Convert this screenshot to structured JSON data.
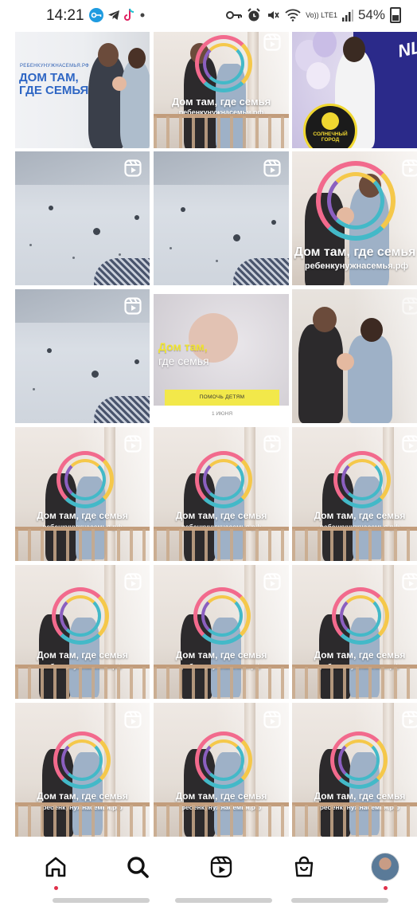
{
  "status_bar": {
    "time": "14:21",
    "network_label": "Vo)) LTE1",
    "battery": "54%",
    "left_icons": [
      "key-icon",
      "telegram-icon",
      "tiktok-icon",
      "dot-icon"
    ],
    "right_icons": [
      "vpn-key-icon",
      "alarm-icon",
      "mute-icon",
      "wifi-icon",
      "signal-icon",
      "battery-icon"
    ]
  },
  "grid": {
    "promo_tile": {
      "site_small": "РЕБЕНКУНУЖНАСЕМЬЯ.РФ",
      "title": "ДОМ ТАМ, ГДЕ СЕМЬЯ"
    },
    "reel_caption": {
      "title": "Дом там, где семья",
      "site": "ребенкунужнасемья.рф"
    },
    "event_tile": {
      "script_text": "NL",
      "badge_text": "СОЛНЕЧНЫЙ ГОРОД"
    },
    "baby_tile": {
      "title_yellow": "Дом там,",
      "title_white": "где семья",
      "help_button": "ПОМОЧЬ ДЕТЯМ",
      "date": "1 ИЮНЯ"
    },
    "reel_icon": "reels-icon"
  },
  "bottom_nav": {
    "items": [
      "home-icon",
      "search-icon",
      "reels-icon",
      "shop-icon",
      "profile-avatar"
    ]
  },
  "colors": {
    "promo_blue": "#2e66c4",
    "baby_yellow": "#f1e530",
    "notification_red": "#e0304a"
  }
}
